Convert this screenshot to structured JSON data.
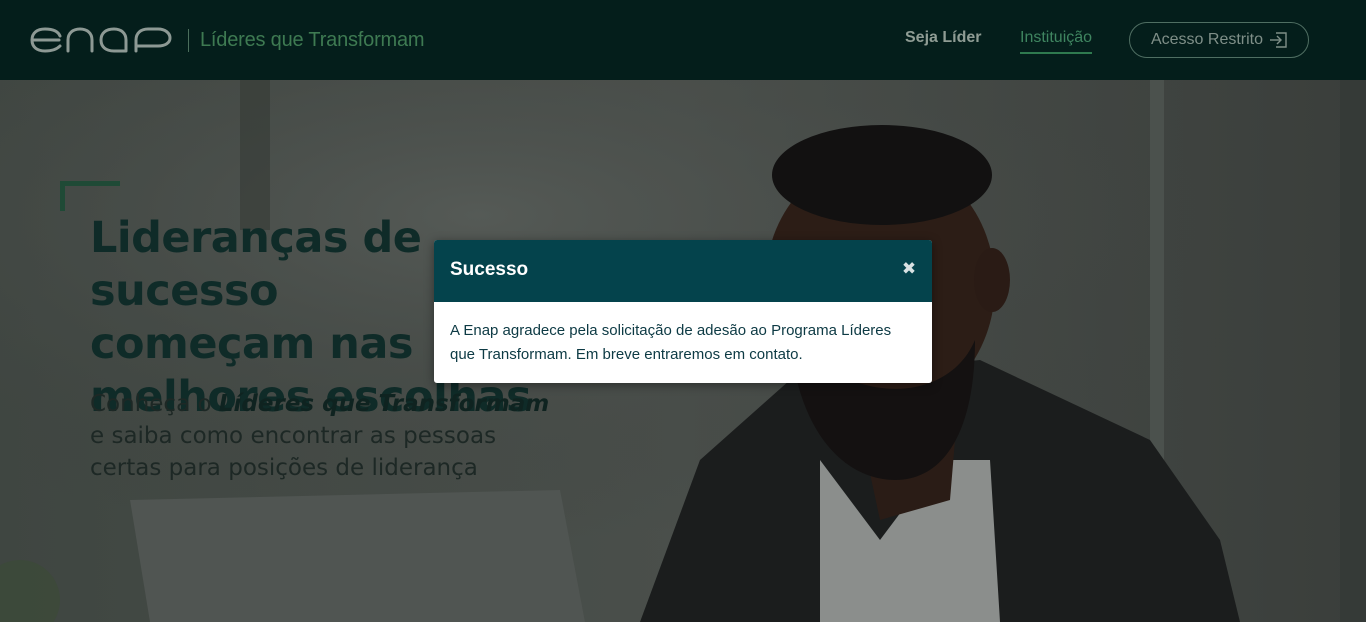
{
  "header": {
    "logo_text": "enap",
    "tagline": "Líderes que Transformam",
    "nav": {
      "seja_lider": "Seja Líder",
      "instituicao": "Instituição",
      "acesso_restrito": "Acesso Restrito"
    }
  },
  "hero": {
    "title_line1": "Lideranças de sucesso",
    "title_line2": "começam nas",
    "title_line3": "melhores escolhas",
    "sub_prefix": "Conheça o ",
    "sub_bold": "Líderes que Transformam",
    "sub_line2": "e saiba como encontrar as pessoas",
    "sub_line3": "certas para posições de liderança"
  },
  "modal": {
    "title": "Sucesso",
    "close_glyph": "✖",
    "message": "A Enap agradece pela solicitação de adesão ao Programa Líderes que Transformam. Em breve entraremos em contato."
  },
  "colors": {
    "header_bg": "#041e1b",
    "modal_header_bg": "#04434c",
    "accent_green": "#2f7a4f"
  }
}
